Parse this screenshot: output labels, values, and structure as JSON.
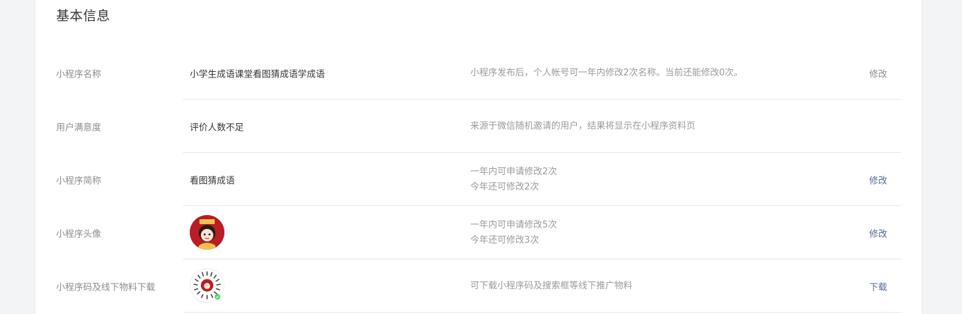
{
  "section": {
    "title": "基本信息"
  },
  "rows": [
    {
      "label": "小程序名称",
      "value": "小学生成语课堂看图猜成语学成语",
      "desc": [
        "小程序发布后，个人帐号可一年内修改2次名称。当前还能修改0次。"
      ],
      "action": "修改"
    },
    {
      "label": "用户满意度",
      "value": "评价人数不足",
      "desc": [
        "来源于微信随机邀请的用户，结果将显示在小程序资料页"
      ]
    },
    {
      "label": "小程序简称",
      "value": "看图猜成语",
      "desc": [
        "一年内可申请修改2次",
        "今年还可修改2次"
      ],
      "action": "修改"
    },
    {
      "label": "小程序头像",
      "desc": [
        "一年内可申请修改5次",
        "今年还可修改3次"
      ],
      "action": "修改",
      "avatar_color": "#b81e24"
    },
    {
      "label": "小程序码及线下物料下载",
      "desc": [
        "可下载小程序码及搜索框等线下推广物料"
      ],
      "action": "下载"
    }
  ],
  "colors": {
    "link": "#576b95",
    "muted": "#8d8d8d"
  }
}
